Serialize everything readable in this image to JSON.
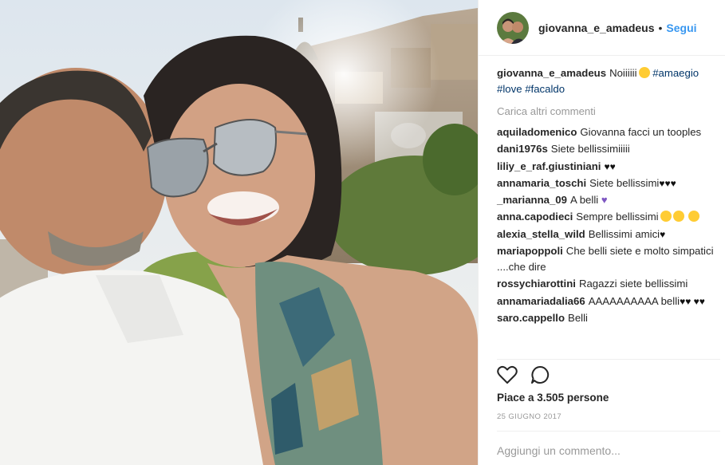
{
  "post": {
    "username": "giovanna_e_amadeus",
    "follow_label": "Segui",
    "separator": "•"
  },
  "caption": {
    "username": "giovanna_e_amadeus",
    "text": "Noiiiiii",
    "hashtags": [
      "#amaegio",
      "#love",
      "#facaldo"
    ]
  },
  "load_more": "Carica altri commenti",
  "comments": [
    {
      "user": "aquiladomenico",
      "text": "Giovanna facci un tooples"
    },
    {
      "user": "dani1976s",
      "text": "Siete bellissimiiiii"
    },
    {
      "user": "liliy_e_raf.giustiniani",
      "text": "",
      "suffix": "♥♥"
    },
    {
      "user": "annamaria_toschi",
      "text": "Siete bellissimi",
      "suffix": "♥♥♥"
    },
    {
      "user": "_marianna_09",
      "text": "A belli",
      "suffix": "♥"
    },
    {
      "user": "anna.capodieci",
      "text": "Sempre bellissimi"
    },
    {
      "user": "alexia_stella_wild",
      "text": "Bellissimi amici",
      "suffix": "♥"
    },
    {
      "user": "mariapoppoli",
      "text": "Che belli siete e molto simpatici ....che dire"
    },
    {
      "user": "rossychiarottini",
      "text": "Ragazzi siete bellissimi"
    },
    {
      "user": "annamariadalia66",
      "text": "AAAAAAAAAA belli",
      "suffix": "♥♥ ♥♥"
    },
    {
      "user": "saro.cappello",
      "text": "Belli"
    }
  ],
  "likes": "Piace a 3.505 persone",
  "date": "25 GIUGNO 2017",
  "comment_input": {
    "placeholder": "Aggiungi un commento..."
  },
  "icons": {
    "like": "heart-outline-icon",
    "comment": "speech-bubble-icon"
  },
  "colors": {
    "link": "#3897f0",
    "hashtag": "#003569",
    "muted": "#999999",
    "text": "#262626"
  }
}
